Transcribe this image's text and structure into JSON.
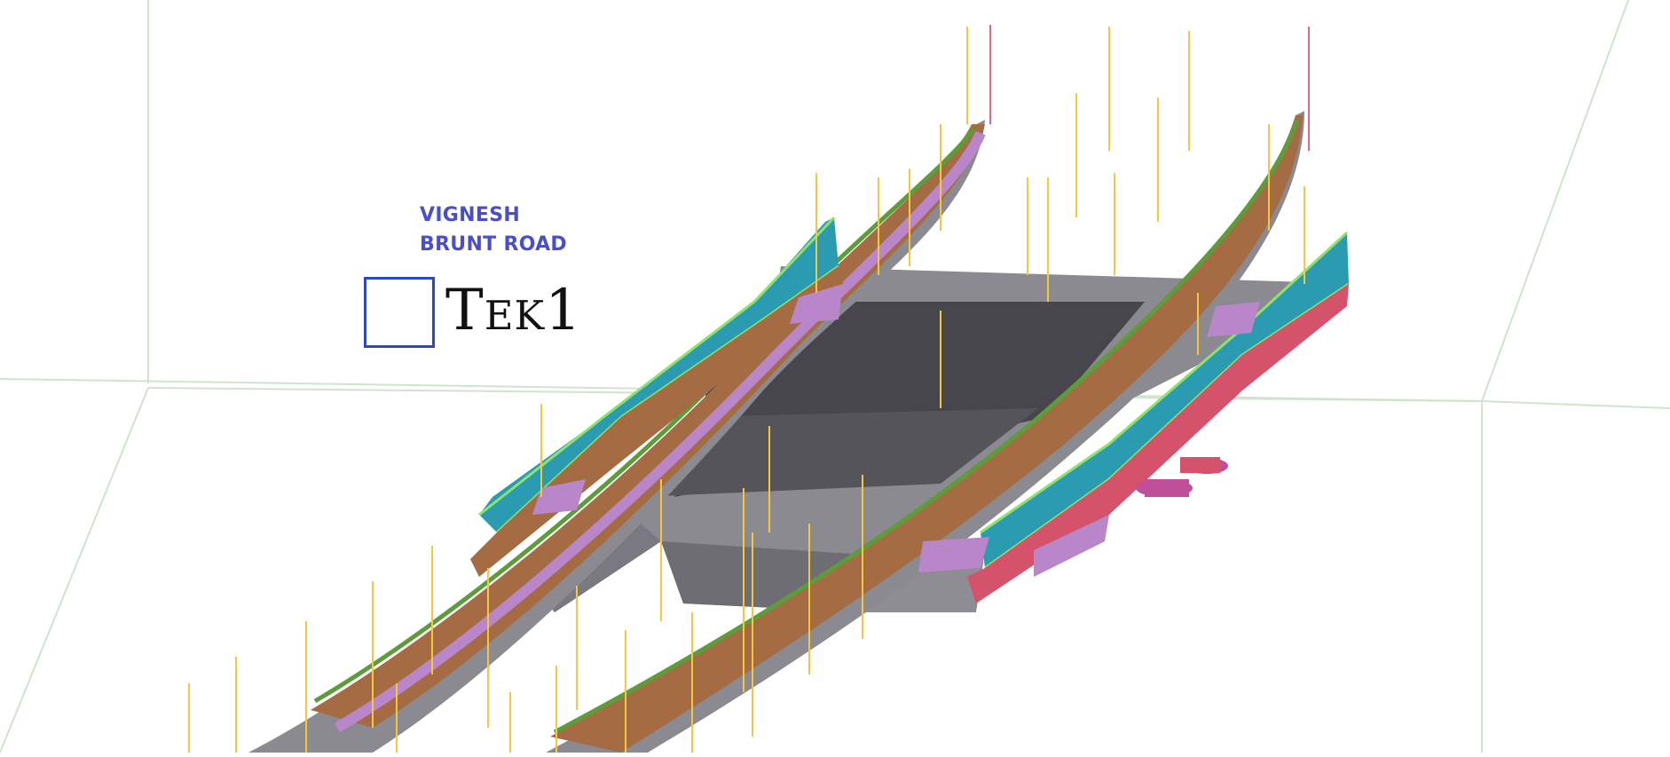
{
  "model_labels": {
    "line1": "VIGNESH",
    "line2": "BRUNT ROAD"
  },
  "logo": {
    "text": "Tek1",
    "box_color": "#2a47c4"
  },
  "colors": {
    "deck": "#8c8a91",
    "deck_dark": "#47464c",
    "deck_edge": "#6f6d74",
    "parapet": "#a56b43",
    "parapet_dark": "#7d4f31",
    "fence": "#2a9bb0",
    "fence_frame": "#8ee36a",
    "post": "#f5c640",
    "grid": "#cfe3cf",
    "magenta": "#c04f9a",
    "pink": "#d4526a",
    "lilac": "#b886c9"
  },
  "icons": {
    "logo_box": "square-outline-icon"
  }
}
